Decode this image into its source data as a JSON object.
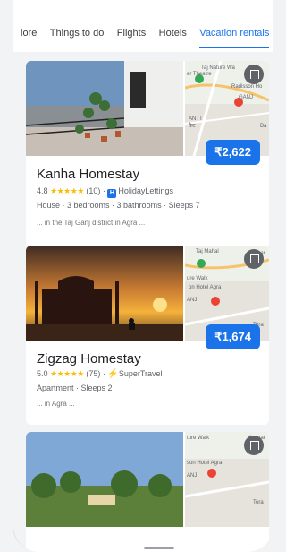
{
  "tabs": [
    {
      "label": "lore",
      "active": false
    },
    {
      "label": "Things to do",
      "active": false
    },
    {
      "label": "Flights",
      "active": false
    },
    {
      "label": "Hotels",
      "active": false
    },
    {
      "label": "Vacation rentals",
      "active": true
    }
  ],
  "listings": [
    {
      "title": "Kanha Homestay",
      "rating": "4.8",
      "stars": "★★★★★",
      "reviews": "(10)",
      "provider": "HolidayLettings",
      "provider_icon": "H",
      "details": "House · 3 bedrooms · 3 bathrooms · Sleeps 7",
      "snippet": "... in the Taj Ganj district in Agra ...",
      "price": "₹2,622",
      "map_labels": [
        "Taj Nature Wa",
        "er Theatre",
        "Radisson Ho",
        "GANJ",
        "ANTT",
        "कैट",
        "Ba"
      ]
    },
    {
      "title": "Zigzag Homestay",
      "rating": "5.0",
      "stars": "★★★★★",
      "reviews": "(75)",
      "provider": "SuperTravel",
      "details": "Apartment · Sleeps 2",
      "snippet": "... in Agra ...",
      "price": "₹1,674",
      "map_labels": [
        "Taj Mahal",
        "ure Walk",
        "on Hotel Agra",
        "ANJ",
        "Karmar",
        "Tora"
      ]
    },
    {
      "map_labels": [
        "ture Walk",
        "son Hotel Agra",
        "ANJ",
        "Karmar",
        "Tora"
      ]
    }
  ],
  "colors": {
    "accent": "#1a73e8",
    "star": "#fbbc04",
    "text": "#202124",
    "subtle": "#5f6368"
  }
}
